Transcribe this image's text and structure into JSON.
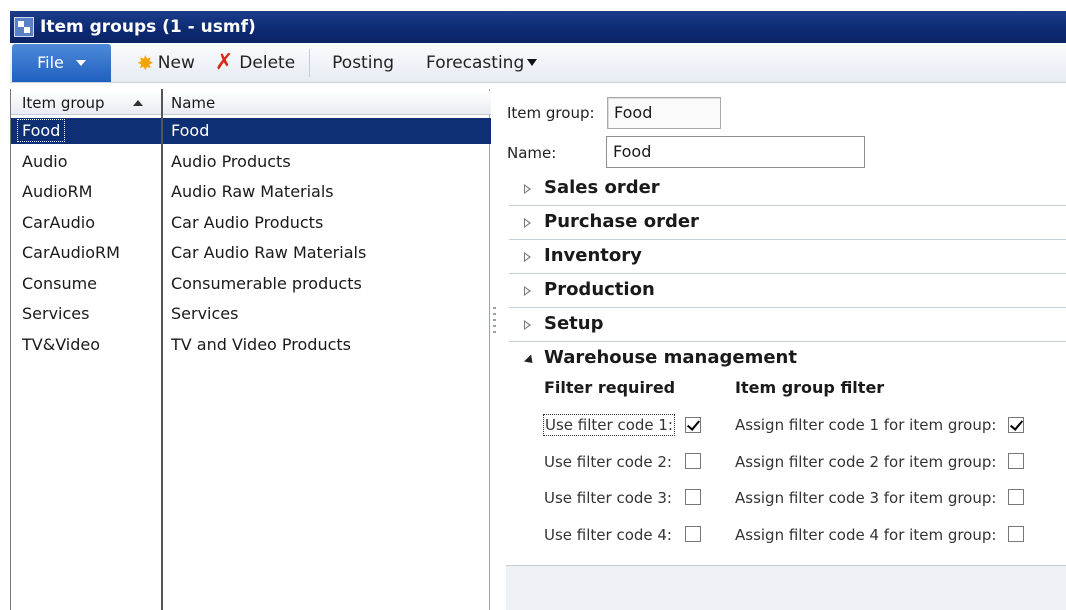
{
  "window": {
    "title": "Item groups (1 - usmf)"
  },
  "toolbar": {
    "file_label": "File",
    "new_label": "New",
    "delete_label": "Delete",
    "posting_label": "Posting",
    "forecasting_label": "Forecasting"
  },
  "grid": {
    "columns": [
      "Item group",
      "Name"
    ],
    "rows": [
      {
        "group": "Food",
        "name": "Food",
        "selected": true
      },
      {
        "group": "Audio",
        "name": "Audio Products"
      },
      {
        "group": "AudioRM",
        "name": "Audio Raw Materials"
      },
      {
        "group": "CarAudio",
        "name": "Car Audio Products"
      },
      {
        "group": "CarAudioRM",
        "name": "Car Audio Raw Materials"
      },
      {
        "group": "Consume",
        "name": "Consumerable products"
      },
      {
        "group": "Services",
        "name": "Services"
      },
      {
        "group": "TV&Video",
        "name": "TV and Video Products"
      }
    ]
  },
  "form": {
    "item_group_label": "Item group:",
    "item_group_value": "Food",
    "name_label": "Name:",
    "name_value": "Food",
    "sections": [
      "Sales order",
      "Purchase order",
      "Inventory",
      "Production",
      "Setup"
    ],
    "warehouse": {
      "title": "Warehouse management",
      "filter_required_heading": "Filter required",
      "item_group_filter_heading": "Item group filter",
      "use_filters": [
        {
          "label": "Use filter code 1:",
          "checked": true
        },
        {
          "label": "Use filter code 2:",
          "checked": false
        },
        {
          "label": "Use filter code 3:",
          "checked": false
        },
        {
          "label": "Use filter code 4:",
          "checked": false
        }
      ],
      "assign_filters": [
        {
          "label": "Assign filter code 1 for item group:",
          "checked": true
        },
        {
          "label": "Assign filter code 2 for item group:",
          "checked": false
        },
        {
          "label": "Assign filter code 3 for item group:",
          "checked": false
        },
        {
          "label": "Assign filter code 4 for item group:",
          "checked": false
        }
      ]
    }
  }
}
